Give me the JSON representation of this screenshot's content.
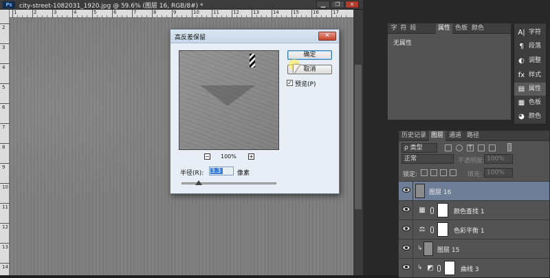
{
  "document": {
    "ps_logo": "Ps",
    "title": "city-street-1082031_1920.jpg @ 59.6% (图层 16, RGB/8#) *",
    "minimize": "▁",
    "restore": "❐",
    "close": "✕",
    "ruler_top": [
      "1",
      "2",
      "3",
      "4",
      "5",
      "6",
      "7",
      "8",
      "9",
      "10",
      "11",
      "12",
      "13",
      "14",
      "15",
      "16",
      "17"
    ],
    "ruler_left": [
      "2",
      "3",
      "4",
      "5",
      "6",
      "7",
      "8",
      "9",
      "10",
      "11",
      "12",
      "13",
      "14"
    ]
  },
  "dialog": {
    "title": "高反差保留",
    "close": "✕",
    "ok_label": "确定",
    "cancel_label": "取消",
    "preview_checked": "✓",
    "preview_label": "预览(P)",
    "zoom_out": "−",
    "zoom_in": "+",
    "zoom_level": "100%",
    "radius_label": "半径(R):",
    "radius_value": "3.3",
    "radius_unit": "像素",
    "accent": "#3a7bd5"
  },
  "properties_panel": {
    "tabs": [
      "字",
      "符",
      "段",
      "属性",
      "色板",
      "颜色"
    ],
    "active_tab": "属性",
    "empty_text": "无属性"
  },
  "tool_dock": [
    {
      "icon": "A|",
      "label": "字符",
      "icon_name": "character-icon"
    },
    {
      "icon": "¶",
      "label": "段落",
      "icon_name": "paragraph-icon"
    },
    {
      "icon": "◐",
      "label": "调整",
      "icon_name": "adjustments-icon"
    },
    {
      "icon": "fx",
      "label": "样式",
      "icon_name": "styles-icon"
    },
    {
      "icon": "▤",
      "label": "属性",
      "icon_name": "properties-icon",
      "active": true
    },
    {
      "icon": "▦",
      "label": "色板",
      "icon_name": "swatches-icon"
    },
    {
      "icon": "◕",
      "label": "颜色",
      "icon_name": "color-icon"
    }
  ],
  "layers_panel": {
    "tabs": [
      "历史记录",
      "图层",
      "通道",
      "路径"
    ],
    "active_tab": "图层",
    "filter_kind": "ρ 类型",
    "blend_mode": "正常",
    "opacity_label": "不透明度:",
    "opacity_value": "100%",
    "lock_label": "锁定:",
    "fill_label": "填充:",
    "fill_value": "100%",
    "layers": [
      {
        "name": "图层 16",
        "type": "pixel",
        "selected": true,
        "visible": true
      },
      {
        "name": "颜色查找 1",
        "type": "color-lookup",
        "visible": true
      },
      {
        "name": "色彩平衡 1",
        "type": "color-balance",
        "visible": true
      },
      {
        "name": "图层 15",
        "type": "pixel",
        "clipped": true,
        "visible": true
      },
      {
        "name": "曲线 3",
        "type": "curves",
        "clipped": true,
        "visible": true
      }
    ],
    "selection_color": "#6d7e96"
  }
}
